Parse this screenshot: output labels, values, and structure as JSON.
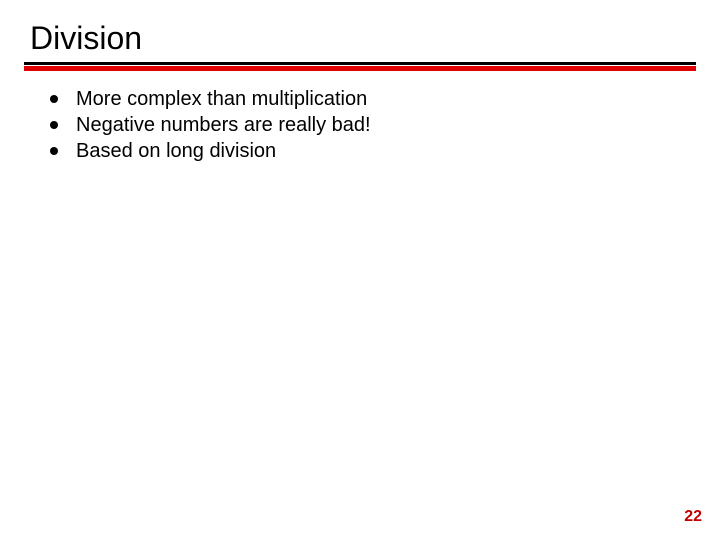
{
  "slide": {
    "title": "Division",
    "bullets": [
      "More complex than multiplication",
      "Negative numbers are really bad!",
      "Based on long division"
    ],
    "page_number": "22"
  }
}
